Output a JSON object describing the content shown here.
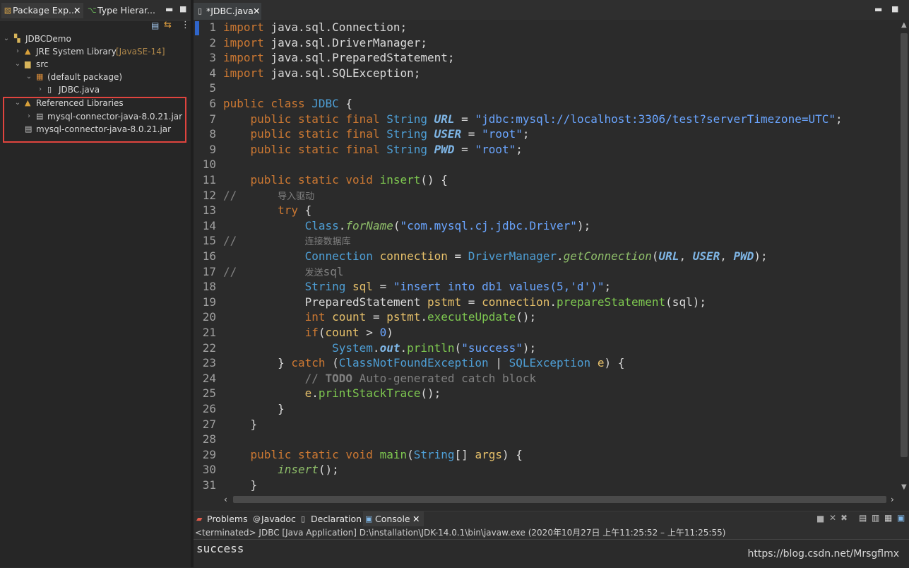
{
  "left_panel": {
    "tabs": [
      {
        "label": "Package Exp...",
        "active": true
      },
      {
        "label": "Type Hierar...",
        "active": false
      }
    ],
    "tree": [
      {
        "label": "JDBCDemo",
        "decoration": "",
        "icon": "project-icon",
        "depth": 0,
        "expanded": true
      },
      {
        "label": "JRE System Library",
        "decoration": "[JavaSE-14]",
        "icon": "library-icon",
        "depth": 1,
        "expanded": false
      },
      {
        "label": "src",
        "decoration": "",
        "icon": "source-folder-icon",
        "depth": 1,
        "expanded": true
      },
      {
        "label": "(default package)",
        "decoration": "",
        "icon": "package-icon",
        "depth": 2,
        "expanded": true
      },
      {
        "label": "JDBC.java",
        "decoration": "",
        "icon": "java-file-icon",
        "depth": 3,
        "expanded": false
      },
      {
        "label": "Referenced Libraries",
        "decoration": "",
        "icon": "library-icon",
        "depth": 1,
        "expanded": true
      },
      {
        "label": "mysql-connector-java-8.0.21.jar",
        "decoration": "",
        "icon": "jar-icon",
        "depth": 2,
        "expanded": false
      },
      {
        "label": "mysql-connector-java-8.0.21.jar",
        "decoration": "",
        "icon": "jar-icon",
        "depth": 1,
        "expanded": null
      }
    ]
  },
  "editor": {
    "tab_label": "*JDBC.java",
    "lines": [
      {
        "n": "1",
        "html": "<span class='kw'>import</span> java.sql.Connection;"
      },
      {
        "n": "2",
        "html": "<span class='kw'>import</span> java.sql.DriverManager;"
      },
      {
        "n": "3",
        "html": "<span class='kw'>import</span> java.sql.PreparedStatement;"
      },
      {
        "n": "4",
        "html": "<span class='kw'>import</span> java.sql.SQLException;"
      },
      {
        "n": "5",
        "html": ""
      },
      {
        "n": "6",
        "html": "<span class='kw'>public class</span> <span class='cls'>JDBC</span> {"
      },
      {
        "n": "7",
        "html": "    <span class='kw'>public static final</span> <span class='cls'>String</span> <span class='sfield'>URL</span> = <span class='str'>\"jdbc:mysql://localhost:3306/test?serverTimezone=UTC\"</span>;"
      },
      {
        "n": "8",
        "html": "    <span class='kw'>public static final</span> <span class='cls'>String</span> <span class='sfield'>USER</span> = <span class='str'>\"root\"</span>;"
      },
      {
        "n": "9",
        "html": "    <span class='kw'>public static final</span> <span class='cls'>String</span> <span class='sfield'>PWD</span> = <span class='str'>\"root\"</span>;"
      },
      {
        "n": "10",
        "html": ""
      },
      {
        "n": "11",
        "html": "    <span class='kw'>public static void</span> <span class='fn'>insert</span>() {"
      },
      {
        "n": "12",
        "html": "<span class='cmt'>//      <span class='cjk'>导入驱动</span></span>"
      },
      {
        "n": "13",
        "html": "        <span class='kw'>try</span> {"
      },
      {
        "n": "14",
        "html": "            <span class='cls'>Class</span>.<span class='smeth'>forName</span>(<span class='str'>\"com.mysql.cj.jdbc.Driver\"</span>);"
      },
      {
        "n": "15",
        "html": "<span class='cmt'>//          <span class='cjk'>连接数据库</span></span>"
      },
      {
        "n": "16",
        "html": "            <span class='cls'>Connection</span> <span class='var'>connection</span> = <span class='cls'>DriverManager</span>.<span class='smeth'>getConnection</span>(<span class='sfield'>URL</span>, <span class='sfield'>USER</span>, <span class='sfield'>PWD</span>);"
      },
      {
        "n": "17",
        "html": "<span class='cmt'>//          <span class='cjk'>发送</span>sql</span>"
      },
      {
        "n": "18",
        "html": "            <span class='cls'>String</span> <span class='var'>sql</span> = <span class='str'>\"insert into db1 values(5,'d')\"</span>;"
      },
      {
        "n": "19",
        "html": "            <span class='plain'>PreparedStatement</span> <span class='var'>pstmt</span> = <span class='var'>connection</span>.<span class='fn'>prepareStatement</span>(sql);"
      },
      {
        "n": "20",
        "html": "            <span class='kw'>int</span> <span class='var'>count</span> = <span class='var'>pstmt</span>.<span class='fn'>executeUpdate</span>();"
      },
      {
        "n": "21",
        "html": "            <span class='kw'>if</span>(<span class='var'>count</span> &gt; <span class='num'>0</span>)"
      },
      {
        "n": "22",
        "html": "                <span class='cls'>System</span>.<span class='sfield'>out</span>.<span class='fn'>println</span>(<span class='str'>\"success\"</span>);"
      },
      {
        "n": "23",
        "html": "        } <span class='kw'>catch</span> (<span class='cls'>ClassNotFoundException</span> | <span class='cls'>SQLException</span> <span class='var'>e</span>) {"
      },
      {
        "n": "24",
        "html": "            <span class='cmt'>// <b>TODO</b> Auto-generated catch block</span>"
      },
      {
        "n": "25",
        "html": "            <span class='var'>e</span>.<span class='fn'>printStackTrace</span>();"
      },
      {
        "n": "26",
        "html": "        }"
      },
      {
        "n": "27",
        "html": "    }"
      },
      {
        "n": "28",
        "html": ""
      },
      {
        "n": "29",
        "html": "    <span class='kw'>public static void</span> <span class='fn'>main</span>(<span class='cls'>String</span>[] <span class='var'>args</span>) {"
      },
      {
        "n": "30",
        "html": "        <span class='smeth'>insert</span>();"
      },
      {
        "n": "31",
        "html": "    }"
      }
    ]
  },
  "console": {
    "tabs": [
      {
        "label": "Problems",
        "icon": "problems-icon",
        "active": false
      },
      {
        "label": "Javadoc",
        "icon": "javadoc-icon",
        "active": false
      },
      {
        "label": "Declaration",
        "icon": "declaration-icon",
        "active": false
      },
      {
        "label": "Console",
        "icon": "console-icon",
        "active": true
      }
    ],
    "status": "<terminated> JDBC [Java Application] D:\\installation\\JDK-14.0.1\\bin\\javaw.exe  (2020年10月27日 上午11:25:52 – 上午11:25:55)",
    "output": "success"
  },
  "watermark": "https://blog.csdn.net/Mrsgflmx",
  "colors": {
    "highlight_box": "#e0443e",
    "keyword": "#cc7832",
    "string": "#6aa5ff",
    "type": "#4e9fd6"
  }
}
